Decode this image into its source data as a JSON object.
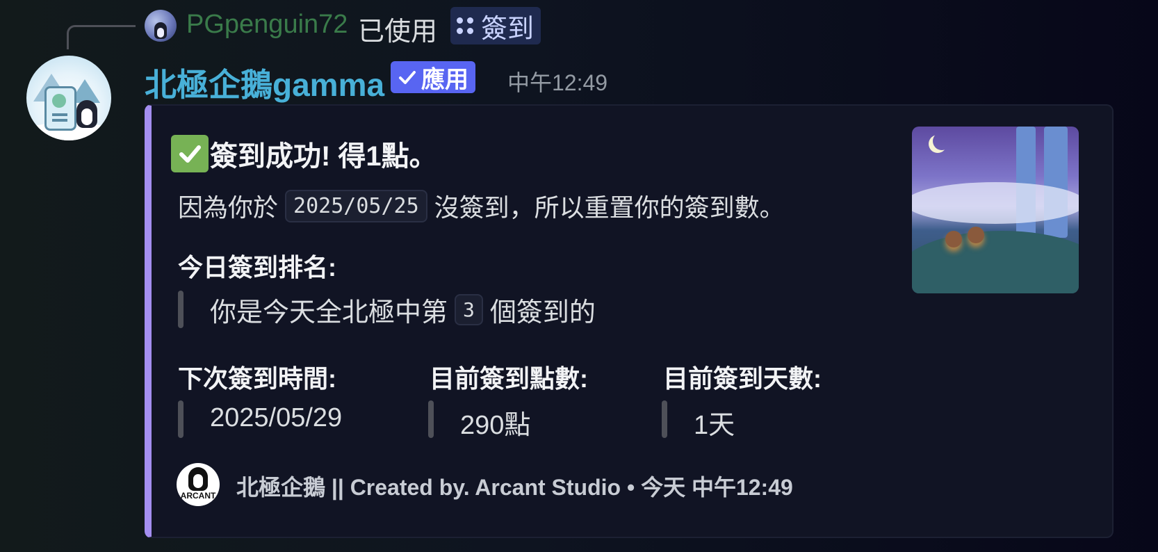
{
  "reply": {
    "username": "PGpenguin72",
    "action": "已使用",
    "command": "簽到"
  },
  "message": {
    "bot_name": "北極企鵝gamma",
    "badge": "應用",
    "timestamp": "中午12:49"
  },
  "embed": {
    "accent_color": "#a48ef0",
    "title": "簽到成功! 得1點。",
    "description": {
      "prefix": "因為你於",
      "date": "2025/05/25",
      "suffix": "沒簽到，所以重置你的簽到數。"
    },
    "rank": {
      "name": "今日簽到排名:",
      "prefix": "你是今天全北極中第",
      "value": "3",
      "suffix": "個簽到的"
    },
    "fields": [
      {
        "name": "下次簽到時間:",
        "value": "2025/05/29"
      },
      {
        "name": "目前簽到點數:",
        "value": "290點"
      },
      {
        "name": "目前簽到天數:",
        "value": "1天"
      }
    ],
    "footer": {
      "icon_text": "ARCANT",
      "text": "北極企鵝 || Created by. Arcant Studio • 今天 中午12:49"
    }
  },
  "icons": {
    "reply_avatar": "user-avatar-icon",
    "command": "slash-command-icon",
    "badge_check": "checkmark-icon",
    "title_emoji": "white-check-mark-emoji",
    "thumbnail": "thumbnail-image",
    "footer": "arcant-studio-logo-icon"
  }
}
